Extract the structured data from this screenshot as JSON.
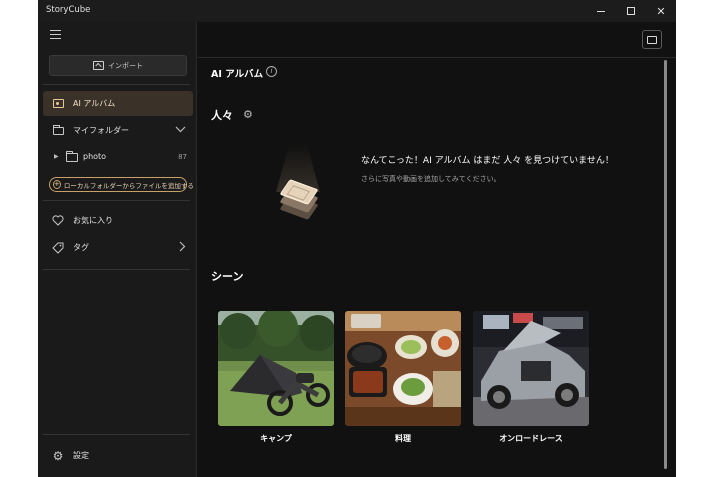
{
  "window": {
    "title": "StoryCube",
    "controls": [
      "minimize",
      "maximize",
      "close"
    ]
  },
  "sidebar": {
    "menu_icon": "hamburger-icon",
    "import_label": "インポート",
    "items": [
      {
        "label": "AI アルバム",
        "icon": "album-icon",
        "active": true
      },
      {
        "label": "マイフォルダー",
        "icon": "folder-icon",
        "expanded": true
      }
    ],
    "tree": [
      {
        "label": "photo",
        "count": "87"
      }
    ],
    "add_folder_label": "ローカルフォルダーからファイルを追加する",
    "bottom_items": [
      {
        "label": "お気に入り",
        "icon": "heart-icon"
      },
      {
        "label": "タグ",
        "icon": "tag-icon"
      }
    ],
    "settings_label": "設定"
  },
  "main": {
    "title": "AI アルバム",
    "people": {
      "heading": "人々",
      "empty_title": "なんてこった！AI アルバム はまだ 人々 を見つけていません！",
      "empty_sub": "さらに写真や動画を追加してみてください。"
    },
    "scenes": {
      "heading": "シーン",
      "cards": [
        {
          "label": "キャンプ"
        },
        {
          "label": "料理"
        },
        {
          "label": "オンロードレース"
        }
      ]
    }
  },
  "colors": {
    "accent": "#c8a06a",
    "active_bg": "#3a3128",
    "background": "#111111",
    "sidebar": "#1a1a1a"
  }
}
